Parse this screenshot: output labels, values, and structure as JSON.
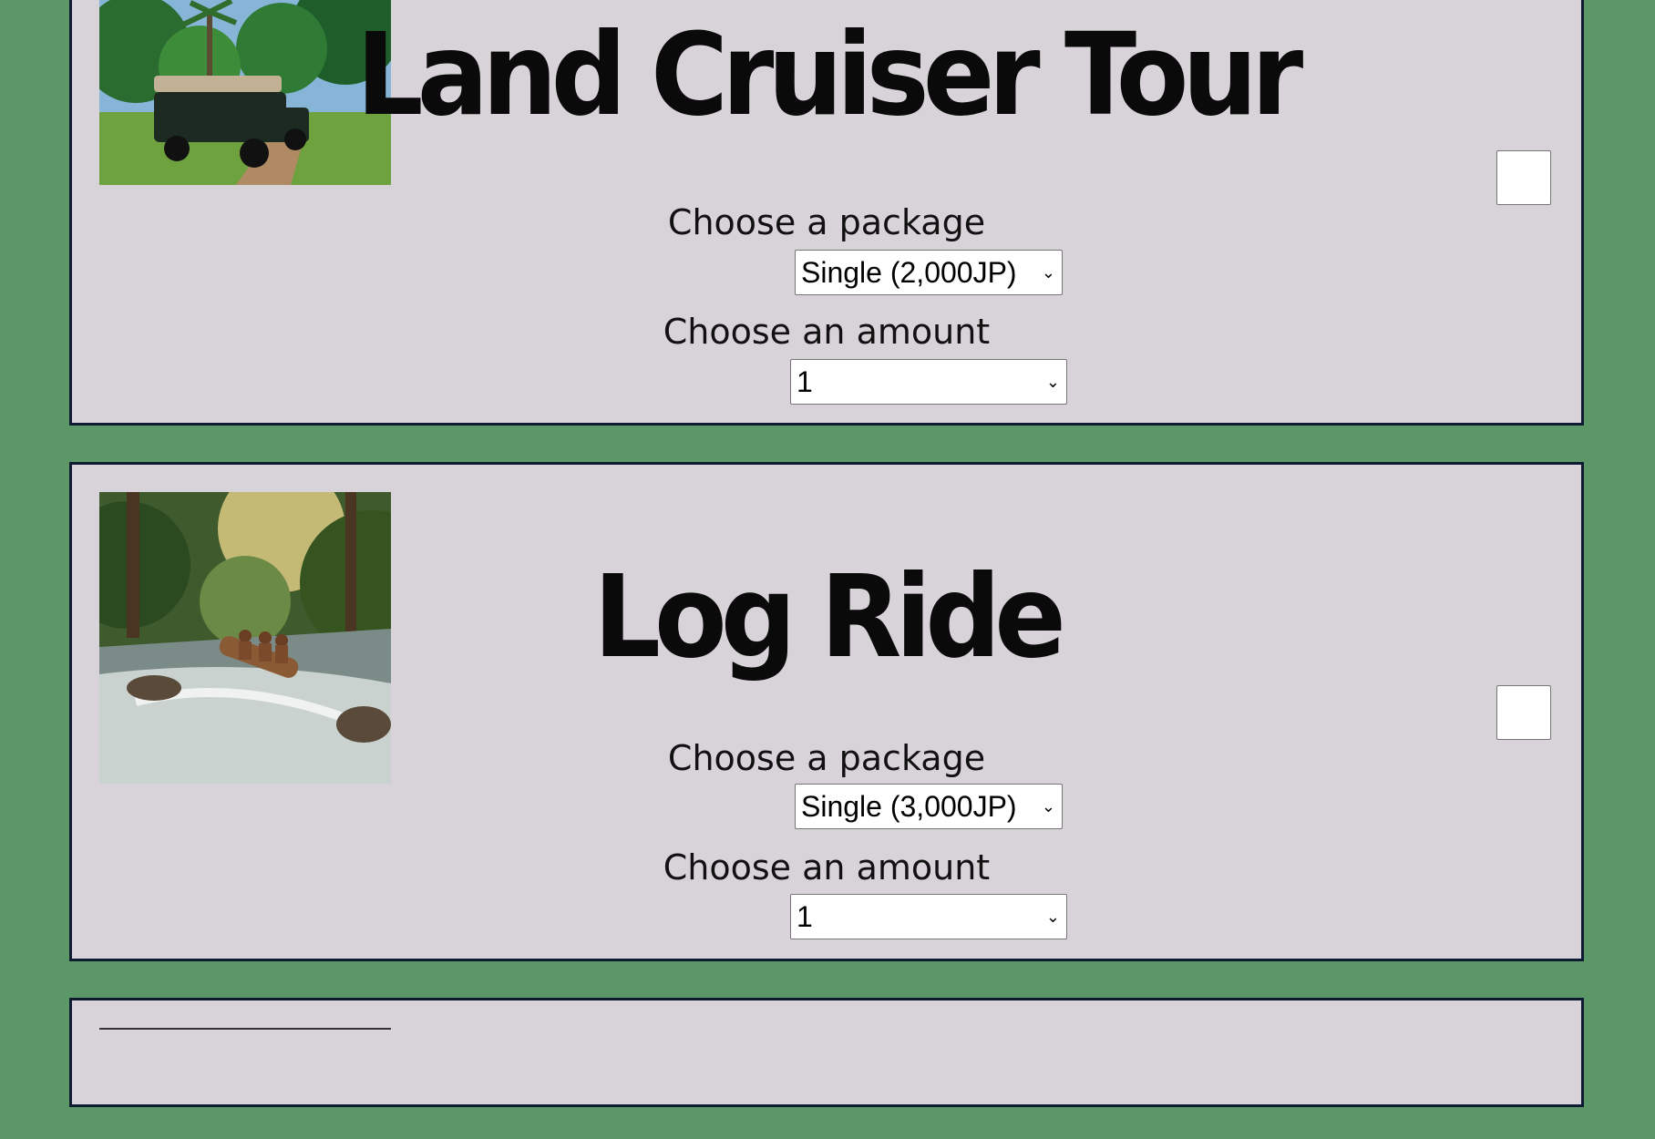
{
  "tours": [
    {
      "title": "Land Cruiser Tour",
      "image_icon": "land-cruiser-photo",
      "package_label": "Choose a package",
      "package_selected": "Single (2,000JP)",
      "amount_label": "Choose an amount",
      "amount_selected": "1",
      "checked": false
    },
    {
      "title": "Log Ride",
      "image_icon": "log-ride-photo",
      "package_label": "Choose a package",
      "package_selected": "Single (3,000JP)",
      "amount_label": "Choose an amount",
      "amount_selected": "1",
      "checked": false
    }
  ],
  "colors": {
    "page_background": "#5b9767",
    "card_background": "#d8d3d8",
    "card_border": "#0f1b33"
  }
}
